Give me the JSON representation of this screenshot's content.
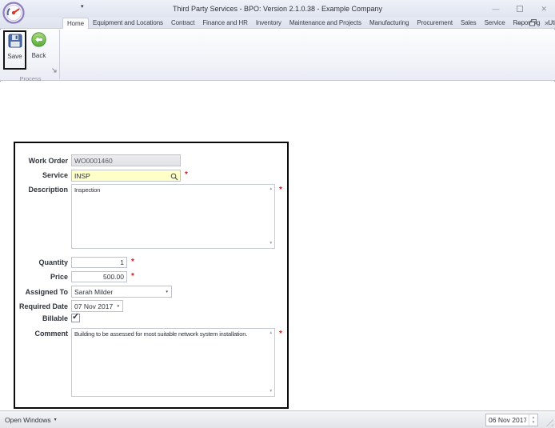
{
  "window": {
    "title": "Third Party Services - BPO: Version 2.1.0.38 - Example Company"
  },
  "ribbon": {
    "tabs": [
      {
        "label": "Home"
      },
      {
        "label": "Equipment and Locations"
      },
      {
        "label": "Contract"
      },
      {
        "label": "Finance and HR"
      },
      {
        "label": "Inventory"
      },
      {
        "label": "Maintenance and Projects"
      },
      {
        "label": "Manufacturing"
      },
      {
        "label": "Procurement"
      },
      {
        "label": "Sales"
      },
      {
        "label": "Service"
      },
      {
        "label": "Reporting"
      },
      {
        "label": "Utilities"
      }
    ],
    "group": {
      "label": "Process",
      "save_label": "Save",
      "back_label": "Back"
    }
  },
  "form": {
    "required_marker": "*",
    "work_order": {
      "label": "Work Order",
      "value": "WO0001460"
    },
    "service": {
      "label": "Service",
      "value": "INSP"
    },
    "description": {
      "label": "Description",
      "value": "Inspection"
    },
    "quantity": {
      "label": "Quantity",
      "value": "1"
    },
    "price": {
      "label": "Price",
      "value": "500.00"
    },
    "assigned_to": {
      "label": "Assigned To",
      "value": "Sarah Milder"
    },
    "required_date": {
      "label": "Required Date",
      "value": "07 Nov 2017"
    },
    "billable": {
      "label": "Billable",
      "checked": true
    },
    "comment": {
      "label": "Comment",
      "value": "Building to be assessed for most suitable network system installation."
    }
  },
  "statusbar": {
    "open_windows_label": "Open Windows",
    "date_value": "06 Nov 2017"
  },
  "icons": {
    "dropdown": "▾",
    "minimize": "—",
    "close": "✕",
    "scroll_up": "▲",
    "scroll_down": "▼",
    "spin_up": "▲",
    "spin_down": "▼",
    "check": "✓"
  },
  "colors": {
    "service_field_bg": "#ffffc8",
    "required": "#cc2222",
    "back_green": "#57a934",
    "save_blue": "#4d6cab",
    "form_border": "#0a0a0a"
  }
}
